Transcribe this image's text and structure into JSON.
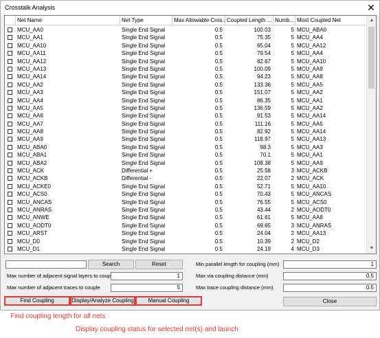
{
  "window": {
    "title": "Crosstalk Analysis",
    "close_glyph": "✕"
  },
  "grid": {
    "columns": [
      "Net Name",
      "Net Type",
      "Max Allowable Cros...",
      "Coupled Length ...",
      "Numb...",
      "Most Coupled Net"
    ],
    "rows": [
      {
        "name": "MCU_AA0",
        "type": "Single End Signal",
        "max": "0.5",
        "len": "100.03",
        "num": "5",
        "most": "MCU_ABA0"
      },
      {
        "name": "MCU_AA1",
        "type": "Single End Signal",
        "max": "0.5",
        "len": "75.35",
        "num": "5",
        "most": "MCU_AA4"
      },
      {
        "name": "MCU_AA10",
        "type": "Single End Signal",
        "max": "0.5",
        "len": "65.04",
        "num": "5",
        "most": "MCU_AA12"
      },
      {
        "name": "MCU_AA11",
        "type": "Single End Signal",
        "max": "0.5",
        "len": "79.54",
        "num": "5",
        "most": "MCU_AA4"
      },
      {
        "name": "MCU_AA12",
        "type": "Single End Signal",
        "max": "0.5",
        "len": "82.67",
        "num": "5",
        "most": "MCU_AA10"
      },
      {
        "name": "MCU_AA13",
        "type": "Single End Signal",
        "max": "0.5",
        "len": "100.09",
        "num": "5",
        "most": "MCU_AA9"
      },
      {
        "name": "MCU_AA14",
        "type": "Single End Signal",
        "max": "0.5",
        "len": "94.23",
        "num": "5",
        "most": "MCU_AA8"
      },
      {
        "name": "MCU_AA2",
        "type": "Single End Signal",
        "max": "0.5",
        "len": "133.36",
        "num": "5",
        "most": "MCU_AA5"
      },
      {
        "name": "MCU_AA3",
        "type": "Single End Signal",
        "max": "0.5",
        "len": "151.07",
        "num": "5",
        "most": "MCU_AA2"
      },
      {
        "name": "MCU_AA4",
        "type": "Single End Signal",
        "max": "0.5",
        "len": "86.35",
        "num": "5",
        "most": "MCU_AA1"
      },
      {
        "name": "MCU_AA5",
        "type": "Single End Signal",
        "max": "0.5",
        "len": "136.59",
        "num": "5",
        "most": "MCU_AA2"
      },
      {
        "name": "MCU_AA6",
        "type": "Single End Signal",
        "max": "0.5",
        "len": "91.53",
        "num": "5",
        "most": "MCU_AA14"
      },
      {
        "name": "MCU_AA7",
        "type": "Single End Signal",
        "max": "0.5",
        "len": "111.16",
        "num": "5",
        "most": "MCU_AA5"
      },
      {
        "name": "MCU_AA8",
        "type": "Single End Signal",
        "max": "0.5",
        "len": "82.92",
        "num": "5",
        "most": "MCU_AA14"
      },
      {
        "name": "MCU_AA9",
        "type": "Single End Signal",
        "max": "0.5",
        "len": "118.97",
        "num": "5",
        "most": "MCU_AA13"
      },
      {
        "name": "MCU_ABA0",
        "type": "Single End Signal",
        "max": "0.5",
        "len": "98.3",
        "num": "5",
        "most": "MCU_AA3"
      },
      {
        "name": "MCU_ABA1",
        "type": "Single End Signal",
        "max": "0.5",
        "len": "70.1",
        "num": "5",
        "most": "MCU_AA1"
      },
      {
        "name": "MCU_ABA2",
        "type": "Single End Signal",
        "max": "0.5",
        "len": "108.38",
        "num": "5",
        "most": "MCU_AA9"
      },
      {
        "name": "MCU_ACK",
        "type": "Differential +",
        "max": "0.5",
        "len": "25.58",
        "num": "3",
        "most": "MCU_ACKB"
      },
      {
        "name": "MCU_ACKB",
        "type": "Differential -",
        "max": "0.5",
        "len": "22.07",
        "num": "2",
        "most": "MCU_ACK"
      },
      {
        "name": "MCU_ACKE0",
        "type": "Single End Signal",
        "max": "0.5",
        "len": "52.71",
        "num": "5",
        "most": "MCU_AA10"
      },
      {
        "name": "MCU_ACS0",
        "type": "Single End Signal",
        "max": "0.5",
        "len": "70.43",
        "num": "5",
        "most": "MCU_ANCAS"
      },
      {
        "name": "MCU_ANCAS",
        "type": "Single End Signal",
        "max": "0.5",
        "len": "76.55",
        "num": "5",
        "most": "MCU_ACS0"
      },
      {
        "name": "MCU_ANRAS",
        "type": "Single End Signal",
        "max": "0.5",
        "len": "43.44",
        "num": "2",
        "most": "MCU_AODT0"
      },
      {
        "name": "MCU_ANWE",
        "type": "Single End Signal",
        "max": "0.5",
        "len": "61.61",
        "num": "5",
        "most": "MCU_AA8"
      },
      {
        "name": "MCU_AODT0",
        "type": "Single End Signal",
        "max": "0.5",
        "len": "69.65",
        "num": "3",
        "most": "MCU_ANRAS"
      },
      {
        "name": "MCU_ARST",
        "type": "Single End Signal",
        "max": "0.5",
        "len": "24.04",
        "num": "2",
        "most": "MCU_AA13"
      },
      {
        "name": "MCU_D0",
        "type": "Single End Signal",
        "max": "0.5",
        "len": "10.39",
        "num": "2",
        "most": "MCU_D2"
      },
      {
        "name": "MCU_D1",
        "type": "Single End Signal",
        "max": "0.5",
        "len": "24.19",
        "num": "4",
        "most": "MCU_D3"
      }
    ]
  },
  "controls": {
    "search_value": "",
    "search_label": "Search",
    "reset_label": "Reset",
    "layers_label": "Max number of adjacent signal layers to couple",
    "layers_value": "1",
    "traces_label": "Max number of adjacent traces to couple",
    "traces_value": "5",
    "min_parallel_label": "Min parallel length for coupling (mm)",
    "min_parallel_value": "1",
    "max_via_label": "Max via coupling distance (mm)",
    "max_via_value": "0.5",
    "max_trace_label": "Max trace coupling distance (mm)",
    "max_trace_value": "0.5",
    "find_label": "Find Coupling",
    "display_label": "Display/Analyze Coupling",
    "manual_label": "Manual Coupling",
    "close_label": "Close"
  },
  "annotations": {
    "note1": "Find coupling length for all nets",
    "note2": "Display coupling status for selected net(s) and launch"
  },
  "colors": {
    "highlight": "#e53935"
  }
}
